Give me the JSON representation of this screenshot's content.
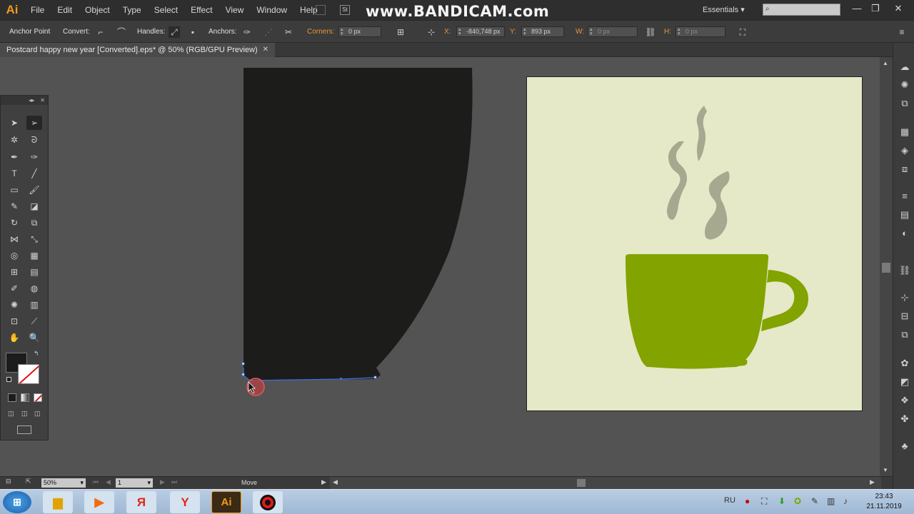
{
  "app": {
    "logo": "Ai",
    "menu": [
      "File",
      "Edit",
      "Object",
      "Type",
      "Select",
      "Effect",
      "View",
      "Window",
      "Help"
    ],
    "watermark": "www.BANDICAM.com",
    "workspace": "Essentials",
    "window_buttons": [
      "—",
      "❐",
      "✕"
    ]
  },
  "controlbar": {
    "mode_label": "Anchor Point",
    "convert_label": "Convert:",
    "handles_label": "Handles:",
    "anchors_label": "Anchors:",
    "corners_label": "Corners:",
    "corners_value": "0 px",
    "x_label": "X:",
    "x_value": "-840,748 px",
    "y_label": "Y:",
    "y_value": "893 px",
    "w_label": "W:",
    "w_value": "0 px",
    "h_label": "H:",
    "h_value": "0 px"
  },
  "document": {
    "tab_title": "Postcard happy new year [Converted].eps* @ 50% (RGB/GPU Preview)",
    "tab_close": "✕"
  },
  "colors": {
    "shape_fill": "#1c1d1b",
    "selection_blue": "#3f6fe0",
    "artboard_bg": "#e5e9c7",
    "cup_green": "#82a300",
    "steam_gray": "#a6a88f",
    "cursor_highlight": "#d9393b"
  },
  "status": {
    "zoom": "50%",
    "page": "1",
    "message": "Move"
  },
  "taskbar": {
    "lang": "RU",
    "time": "23:43",
    "date": "21.11.2019",
    "apps": [
      "windows-start",
      "file-explorer",
      "media-player",
      "yandex",
      "yandex-browser",
      "illustrator",
      "bandicam"
    ]
  }
}
